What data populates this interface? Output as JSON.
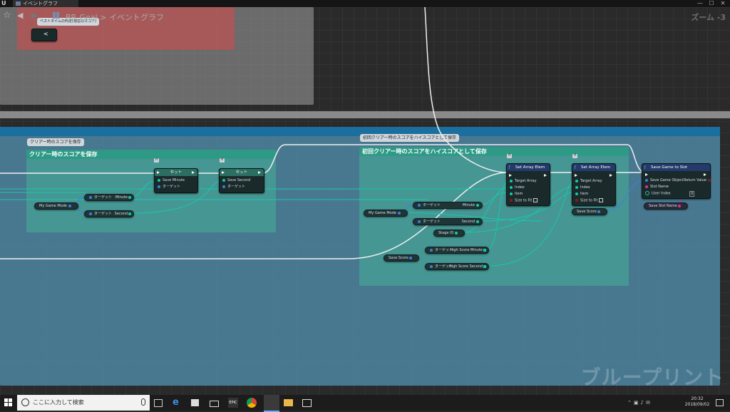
{
  "window": {
    "tab_title": "イベントグラフ",
    "minimize": "—",
    "maximize": "☐",
    "close": "✕"
  },
  "toolbar": {
    "star": "☆",
    "back": "◀",
    "forward": "▶",
    "breadcrumb_root": "BP_Goal",
    "breadcrumb_sep": ">",
    "breadcrumb_current": "イベントグラフ",
    "zoom": "ズーム -3"
  },
  "watermark": "ブループリント",
  "top_comment": {
    "bubble": "ベストタイムの判定(現在のスコア)",
    "compare_label": "<"
  },
  "comment1": {
    "bubble": "クリアー時のスコアを保存",
    "title": "クリアー時のスコアを保存"
  },
  "comment2": {
    "bubble": "初回クリアー時のスコアをハイスコアとして保存",
    "title": "初回クリアー時のスコアをハイスコアとして保存"
  },
  "nodes": {
    "set1": {
      "title": "セット",
      "tag": "ff",
      "pin_value": "Save Minute",
      "pin_target": "ターゲット"
    },
    "set2": {
      "title": "セット",
      "tag": "ff",
      "pin_value": "Save Second",
      "pin_target": "ターゲット"
    },
    "arr1": {
      "title": "Set Array Elem",
      "tag": "ff",
      "pins": [
        "Target Array",
        "Index",
        "Item",
        "Size to Fit"
      ]
    },
    "arr2": {
      "title": "Set Array Elem",
      "tag": "ff",
      "pins": [
        "Target Array",
        "Index",
        "Item",
        "Size to Fit"
      ]
    },
    "save": {
      "title": "Save Game to Slot",
      "pins": [
        "Save Game Object",
        "Slot Name",
        "User Index"
      ],
      "return": "Return Value",
      "user_index": "0"
    }
  },
  "vars": {
    "mygamemode1": "My Game Mode",
    "minute1_target": "ターゲット",
    "minute1": "Minute",
    "second1_target": "ターゲット",
    "second1": "Second",
    "mygamemode2": "My Game Mode",
    "minute2_target": "ターゲット",
    "minute2": "Minute",
    "second2_target": "ターゲット",
    "second2": "Second",
    "stageid": "Stage ID",
    "savescore1": "Save Score",
    "hsm_target": "ターゲット",
    "hsm": "High Score Minute",
    "hss_target": "ターゲット",
    "hss": "High Score Second",
    "savescore2": "Save Score",
    "saveslotname": "Save Slot Name"
  },
  "taskbar": {
    "search_placeholder": "ここに入力して検索",
    "time": "20:32",
    "date": "2018/09/02"
  }
}
